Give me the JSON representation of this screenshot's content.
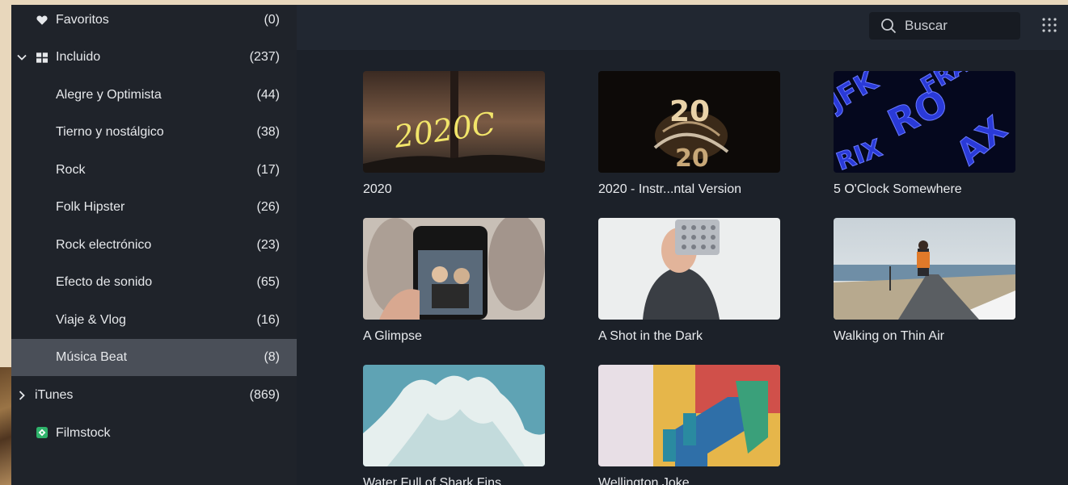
{
  "sidebar": {
    "items": [
      {
        "label": "Favoritos",
        "count": "(0)",
        "icon": "heart-icon"
      },
      {
        "label": "Incluido",
        "count": "(237)",
        "icon": "grid-icon",
        "expanded": true
      },
      {
        "label": "Alegre y Optimista",
        "count": "(44)"
      },
      {
        "label": "Tierno y nostálgico",
        "count": "(38)"
      },
      {
        "label": "Rock",
        "count": "(17)"
      },
      {
        "label": "Folk Hipster",
        "count": "(26)"
      },
      {
        "label": "Rock electrónico",
        "count": "(23)"
      },
      {
        "label": "Efecto de sonido",
        "count": "(65)"
      },
      {
        "label": "Viaje & Vlog",
        "count": "(16)"
      },
      {
        "label": "Música Beat",
        "count": "(8)",
        "selected": true
      },
      {
        "label": "iTunes",
        "count": "(869)",
        "collapsed": true
      },
      {
        "label": "Filmstock",
        "count": "",
        "icon": "filmstock-icon"
      }
    ]
  },
  "toolbar": {
    "search_placeholder": "Buscar",
    "search_icon": "search-icon",
    "grid_icon": "grid-dots-icon"
  },
  "tracks": [
    {
      "title": "2020"
    },
    {
      "title": "2020 - Instr...ntal Version"
    },
    {
      "title": "5 O'Clock Somewhere"
    },
    {
      "title": "A Glimpse"
    },
    {
      "title": "A Shot in the Dark"
    },
    {
      "title": "Walking on Thin Air"
    },
    {
      "title": "Water Full of Shark Fins"
    },
    {
      "title": "Wellington Joke"
    }
  ],
  "colors": {
    "sidebar_bg": "#1f232a",
    "selected_bg": "#4a4f58",
    "main_bg": "#1c2129",
    "text": "#e6e8eb"
  }
}
